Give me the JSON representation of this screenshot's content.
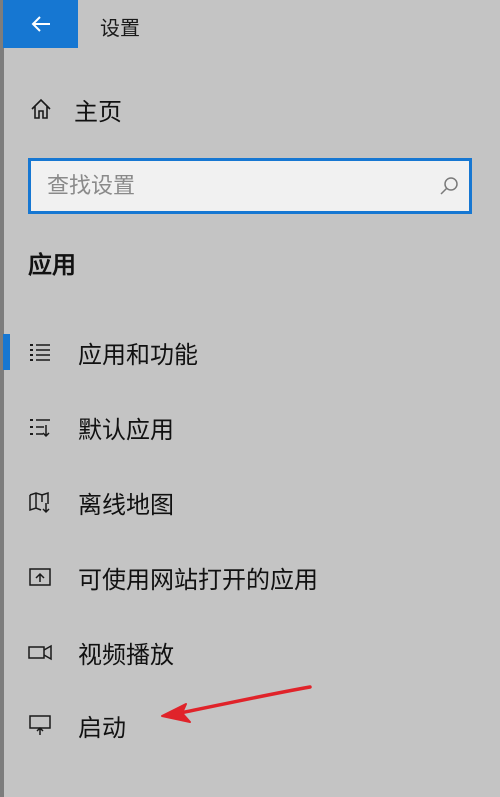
{
  "window": {
    "title": "设置"
  },
  "home": {
    "label": "主页"
  },
  "search": {
    "placeholder": "查找设置"
  },
  "section": {
    "title": "应用"
  },
  "nav": {
    "items": [
      {
        "label": "应用和功能",
        "icon": "apps-features-icon",
        "selected": true
      },
      {
        "label": "默认应用",
        "icon": "default-apps-icon",
        "selected": false
      },
      {
        "label": "离线地图",
        "icon": "offline-maps-icon",
        "selected": false
      },
      {
        "label": "可使用网站打开的应用",
        "icon": "apps-for-websites-icon",
        "selected": false
      },
      {
        "label": "视频播放",
        "icon": "video-playback-icon",
        "selected": false
      },
      {
        "label": "启动",
        "icon": "startup-icon",
        "selected": false
      }
    ]
  },
  "colors": {
    "background": "#c4c4c4",
    "accent": "#1677d2",
    "annotation_arrow": "#e0232a"
  }
}
